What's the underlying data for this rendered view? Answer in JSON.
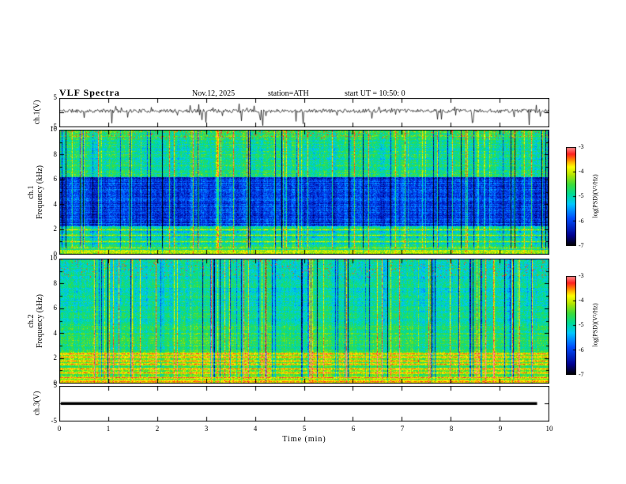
{
  "header": {
    "title": "VLF Spectra",
    "date": "Nov.12, 2025",
    "station": "station=ATH",
    "start_ut": "start UT =  10:50: 0"
  },
  "xaxis": {
    "label": "Time  (min)",
    "tick_labels": [
      "0",
      "1",
      "2",
      "3",
      "4",
      "5",
      "6",
      "7",
      "8",
      "9",
      "10"
    ],
    "range": [
      0,
      10
    ]
  },
  "panels": {
    "ch1_wave": {
      "ylabel": "ch.1(V)",
      "ytick_labels": [
        "5",
        "-5"
      ]
    },
    "ch1_spec": {
      "ylabel_channel": "ch.1",
      "ylabel_axis": "Frequency  (kHz)",
      "ytick_labels": [
        "10",
        "8",
        "6",
        "4",
        "2",
        "0"
      ]
    },
    "ch2_spec": {
      "ylabel_channel": "ch.2",
      "ylabel_axis": "Frequency  (kHz)",
      "ytick_labels": [
        "10",
        "8",
        "6",
        "4",
        "2",
        "0"
      ]
    },
    "ch3_wave": {
      "ylabel": "ch.3(V)",
      "ytick_labels": [
        "5",
        "-5"
      ]
    }
  },
  "colorbar": {
    "label": "log(PSD)(V²/Hz)",
    "tick_labels": [
      "-3",
      "-4",
      "-5",
      "-6",
      "-7"
    ],
    "range": [
      -7,
      -3
    ]
  },
  "colormap": {
    "stops": [
      [
        0.0,
        "#000000"
      ],
      [
        0.1,
        "#000090"
      ],
      [
        0.28,
        "#0050ff"
      ],
      [
        0.42,
        "#00c8ff"
      ],
      [
        0.52,
        "#00dc96"
      ],
      [
        0.62,
        "#3cdc3c"
      ],
      [
        0.72,
        "#b4e600"
      ],
      [
        0.8,
        "#ffff00"
      ],
      [
        0.87,
        "#ff8c00"
      ],
      [
        0.93,
        "#ff2020"
      ],
      [
        1.0,
        "#ff9696"
      ]
    ]
  },
  "chart_data": [
    {
      "id": "ch1_waveform",
      "type": "line",
      "ylabel": "ch.1(V)",
      "xlabel": "Time (min)",
      "xlim": [
        0,
        10
      ],
      "ylim": [
        -5,
        5
      ],
      "yticks": [
        -5,
        0,
        5
      ],
      "description": "broadband noise trace centered near +0.5 V with frequent impulsive downward spikes reaching -4 to -5 V and occasional upward spikes",
      "baseline": 0.5,
      "noise_amp": 1.3,
      "spike_down_prob": 0.05,
      "spike_up_prob": 0.02,
      "seed": 11
    },
    {
      "id": "ch1_spectrogram",
      "type": "heatmap",
      "ylabel": "ch.1 Frequency (kHz)",
      "xlim": [
        0,
        10
      ],
      "ylim": [
        0,
        10
      ],
      "yticks": [
        0,
        2,
        4,
        6,
        8,
        10
      ],
      "yticks_minor": [
        1,
        3,
        5,
        7,
        9
      ],
      "colorbar_range": [
        -7,
        -3
      ],
      "bands": [
        {
          "f": [
            0,
            0.35
          ],
          "level": 0.72
        },
        {
          "f": [
            0.35,
            0.8
          ],
          "level": 0.55
        },
        {
          "f": [
            0.8,
            2.6
          ],
          "level": 0.48
        },
        {
          "f": [
            2.6,
            6.2
          ],
          "level": 0.24
        },
        {
          "f": [
            6.2,
            9.4
          ],
          "level": 0.54
        },
        {
          "f": [
            9.4,
            10
          ],
          "level": 0.58
        }
      ],
      "horizontal_lines_khz": [
        0.5,
        1.0,
        1.5,
        2.0
      ],
      "line_level": 0.72,
      "dark_lines_khz": [
        2.35,
        2.55
      ],
      "dark_line_level": 0.22,
      "row_noise": 0.12,
      "pixel_noise": 0.18,
      "bright_stripe_prob": 0.1,
      "dark_stripe_prob": 0.06,
      "speckle": {
        "f_min": 9.3,
        "prob": 0.07,
        "level": 0.9
      },
      "seed": 42
    },
    {
      "id": "ch2_spectrogram",
      "type": "heatmap",
      "ylabel": "ch.2 Frequency (kHz)",
      "xlim": [
        0,
        10
      ],
      "ylim": [
        0,
        10
      ],
      "yticks": [
        0,
        2,
        4,
        6,
        8,
        10
      ],
      "yticks_minor": [
        1,
        3,
        5,
        7,
        9
      ],
      "colorbar_range": [
        -7,
        -3
      ],
      "bands": [
        {
          "f": [
            0,
            0.3
          ],
          "level": 0.78
        },
        {
          "f": [
            0.3,
            2.5
          ],
          "level": 0.62
        },
        {
          "f": [
            2.5,
            4.6
          ],
          "level": 0.56
        },
        {
          "f": [
            4.6,
            10
          ],
          "level": 0.5
        }
      ],
      "horizontal_lines_khz": [
        0.12,
        0.45,
        0.8,
        1.15,
        1.5,
        1.8,
        2.1,
        2.35
      ],
      "line_level": 0.88,
      "dark_lines_khz": [],
      "dark_line_level": 0.25,
      "row_noise": 0.1,
      "pixel_noise": 0.16,
      "bright_stripe_prob": 0.08,
      "dark_stripe_prob": 0.07,
      "speckle": {
        "f_min": 8.5,
        "prob": 0.03,
        "level": 0.92
      },
      "seed": 7
    },
    {
      "id": "ch3_waveform",
      "type": "line",
      "ylabel": "ch.3(V)",
      "xlim": [
        0,
        10
      ],
      "ylim": [
        -5,
        5
      ],
      "yticks": [
        -5,
        0,
        5
      ],
      "description": "flat zero-volt trace (no signal), thick black line ending near 9.75 min",
      "flat_value": 0,
      "end_x": 9.75,
      "seed": 3
    }
  ]
}
